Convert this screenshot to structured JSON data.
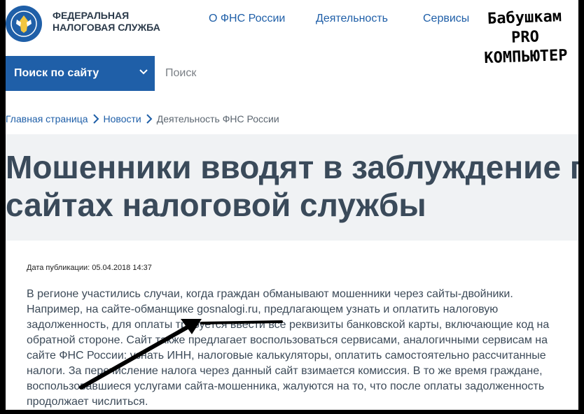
{
  "header": {
    "org_name_line1": "ФЕДЕРАЛЬНАЯ",
    "org_name_line2": "НАЛОГОВАЯ СЛУЖБА",
    "nav": [
      "О ФНС России",
      "Деятельность",
      "Сервисы"
    ]
  },
  "search": {
    "scope_label": "Поиск по сайту",
    "placeholder": "Поиск"
  },
  "breadcrumbs": [
    "Главная страница",
    "Новости",
    "Деятельность ФНС России"
  ],
  "article": {
    "title_line1": "Мошенники вводят в заблуждение гр",
    "title_line2": "сайтах налоговой службы",
    "date": "Дата публикации: 05.04.2018 14:37",
    "lines": [
      "В регионе участились случаи, когда граждан обманывают мошенники через сайты-двойники.",
      "Например, на сайте-обманщике gosnalogi.ru, предлагающем узнать и оплатить налоговую",
      "задолженность, для оплаты требуется ввести все реквизиты банковской карты, включающие код на",
      "обратной стороне. Сайт также предлагает воспользоваться сервисами, аналогичными сервисам на",
      "сайте ФНС России: узнать ИНН, налоговые калькуляторы, оплатить самостоятельно рассчитанные",
      "налоги. За перечисление налога через данный сайт взимается комиссия. В то же время граждане,",
      "воспользовавшиеся услугами сайта-мошенника, жалуются на то, что после оплаты задолженность",
      "продолжает числиться."
    ]
  },
  "overlay": {
    "line1": "Бабушкам",
    "line2": "PRO",
    "line3": "КОМПЬЮТЕР"
  },
  "colors": {
    "brand_blue": "#1f5fa8",
    "title_gray": "#3a4a5a",
    "band_gray": "#f0f2f4"
  }
}
